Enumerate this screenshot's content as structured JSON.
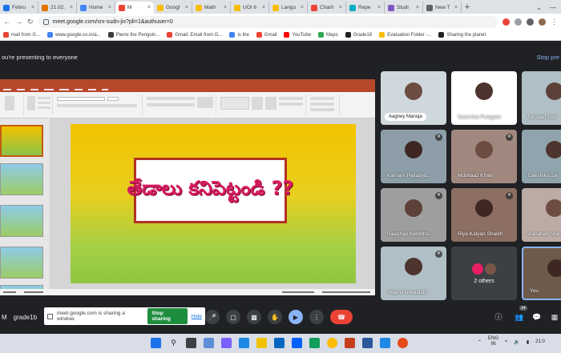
{
  "tabs": [
    {
      "label": "Febru",
      "color": "#1a73e8"
    },
    {
      "label": "21.02.",
      "color": "#e37400"
    },
    {
      "label": "Home",
      "color": "#4285f4"
    },
    {
      "label": "M",
      "color": "#ea4335",
      "active": true
    },
    {
      "label": "Googl",
      "color": "#fbbc04"
    },
    {
      "label": "Math",
      "color": "#fbbc04"
    },
    {
      "label": "UOI 6",
      "color": "#fbbc04"
    },
    {
      "label": "Langu",
      "color": "#fbbc04"
    },
    {
      "label": "Charli",
      "color": "#ea4335"
    },
    {
      "label": "Repe",
      "color": "#00acc1"
    },
    {
      "label": "Studi",
      "color": "#7e57c2"
    },
    {
      "label": "New T",
      "color": "#5f6368"
    }
  ],
  "new_tab": "+",
  "address": {
    "url": "meet.google.com/srx-sudn-jix?pli=1&authuser=0"
  },
  "bookmarks": [
    {
      "label": "mail from G...",
      "color": "#ea4335"
    },
    {
      "label": "www.google.co.in/a...",
      "color": "#4285f4"
    },
    {
      "label": "Pierre the Penguin...",
      "color": "#3c4043"
    },
    {
      "label": "Gmail: Email from G...",
      "color": "#ea4335"
    },
    {
      "label": "is the",
      "color": "#4285f4"
    },
    {
      "label": "Gmail",
      "color": "#ea4335"
    },
    {
      "label": "YouTube",
      "color": "#ff0000"
    },
    {
      "label": "Maps",
      "color": "#34a853"
    },
    {
      "label": "Grade18",
      "color": "#202124"
    },
    {
      "label": "Evaluation Folder -...",
      "color": "#fbbc04"
    },
    {
      "label": "Sharing the planet",
      "color": "#202124"
    }
  ],
  "presenting": {
    "text": "ou're presenting to everyone",
    "stop": "Stop pre"
  },
  "slide": {
    "text": "తేడాలు కనిపెట్టండి ??"
  },
  "participants": [
    {
      "name": "Aagney Manoja",
      "style": "pill",
      "muted": false
    },
    {
      "name": "Saanvika Pulagam",
      "muted": false
    },
    {
      "name": "Nirvaan Dsc",
      "muted": false
    },
    {
      "name": "Karnam Palladyd...",
      "muted": true
    },
    {
      "name": "Mdshaaz Khan",
      "muted": true
    },
    {
      "name": "Dakshika Sa",
      "muted": true
    },
    {
      "name": "Raaghav Kambha...",
      "muted": true
    },
    {
      "name": "Riya Kalyan Shaikh",
      "muted": true
    },
    {
      "name": "Aananah She",
      "muted": true
    },
    {
      "name": "Helen Pinwalashi",
      "muted": true
    },
    {
      "name": "2 others",
      "others": true
    },
    {
      "name": "You",
      "muted": false
    }
  ],
  "controls": {
    "meet_label": "M",
    "meeting_code": "grade1b",
    "share_notice": "meet.google.com is sharing a window.",
    "stop_sharing": "Stop sharing",
    "hide": "Hide",
    "people_count": "14"
  },
  "tray": {
    "lang_top": "ENG",
    "lang_bottom": "IN",
    "time": "21:0"
  }
}
